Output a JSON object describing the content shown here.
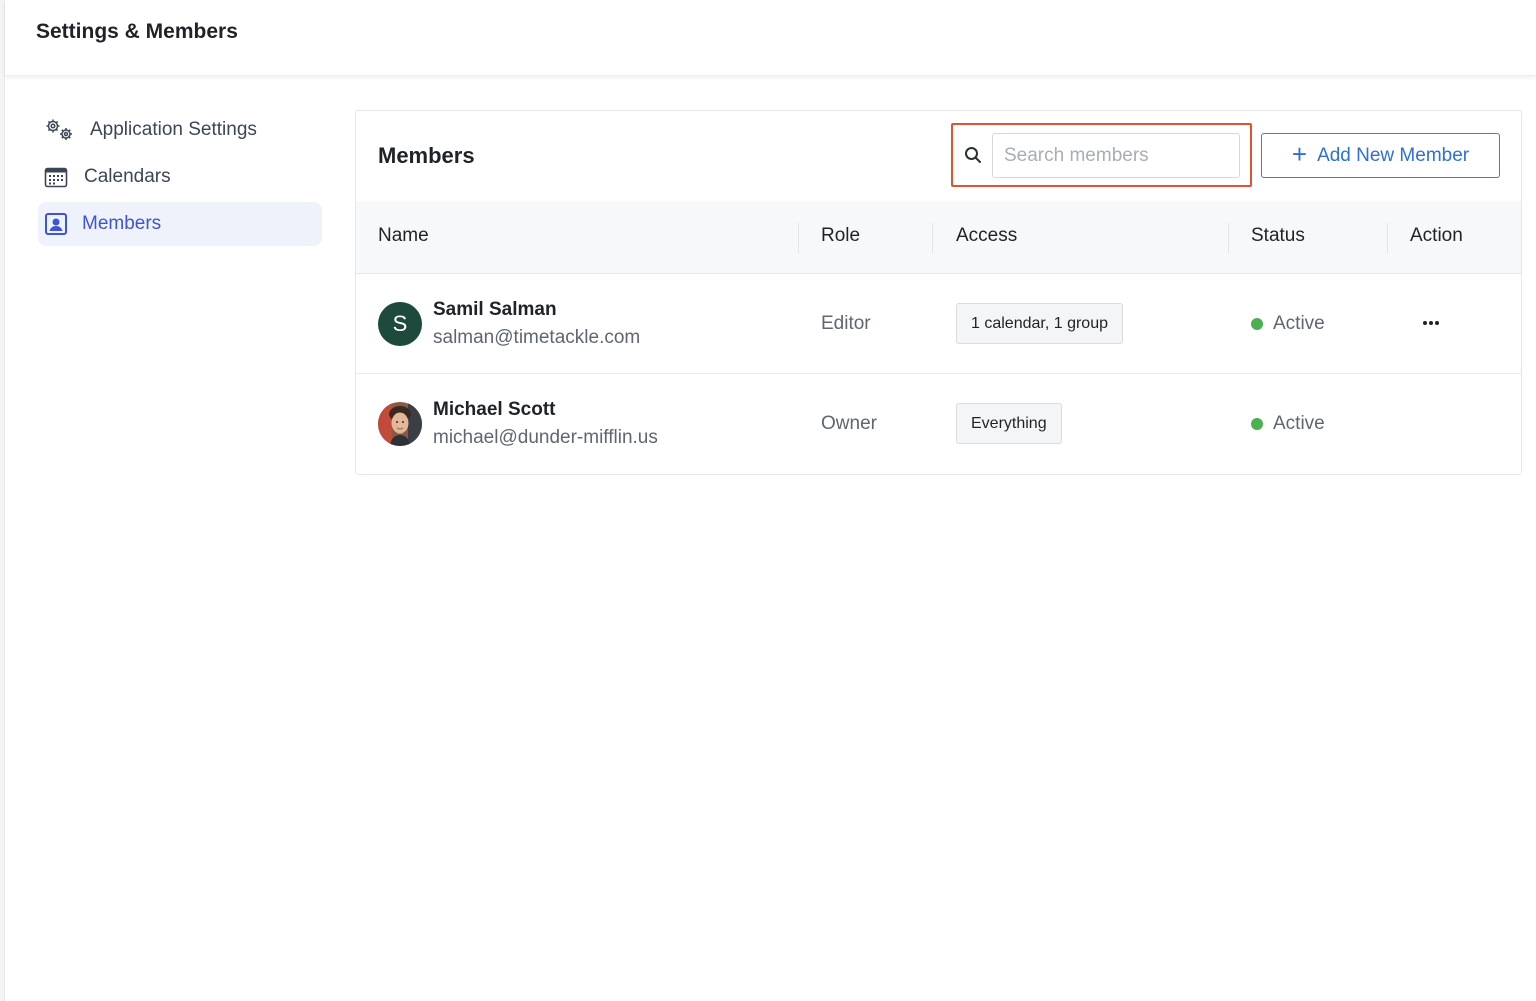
{
  "header": {
    "title": "Settings & Members"
  },
  "sidebar": {
    "items": [
      {
        "label": "Application Settings",
        "icon": "gears-icon",
        "active": false
      },
      {
        "label": "Calendars",
        "icon": "calendar-icon",
        "active": false
      },
      {
        "label": "Members",
        "icon": "member-card-icon",
        "active": true
      }
    ]
  },
  "members_panel": {
    "title": "Members",
    "search": {
      "placeholder": "Search members",
      "value": ""
    },
    "add_button_label": "Add New Member",
    "columns": [
      "Name",
      "Role",
      "Access",
      "Status",
      "Action"
    ],
    "rows": [
      {
        "name": "Samil Salman",
        "email": "salman@timetackle.com",
        "avatar_initial": "S",
        "role": "Editor",
        "access": "1 calendar, 1 group",
        "status": "Active",
        "has_action_menu": true
      },
      {
        "name": "Michael Scott",
        "email": "michael@dunder-mifflin.us",
        "avatar_initial": "",
        "role": "Owner",
        "access": "Everything",
        "status": "Active",
        "has_action_menu": false
      }
    ]
  },
  "colors": {
    "accent": "#3b55d4",
    "button_blue": "#2f6fd9",
    "highlight_box": "#e0532f",
    "status_active": "#4caf50",
    "avatar_initial_bg": "#1d4a3c"
  }
}
